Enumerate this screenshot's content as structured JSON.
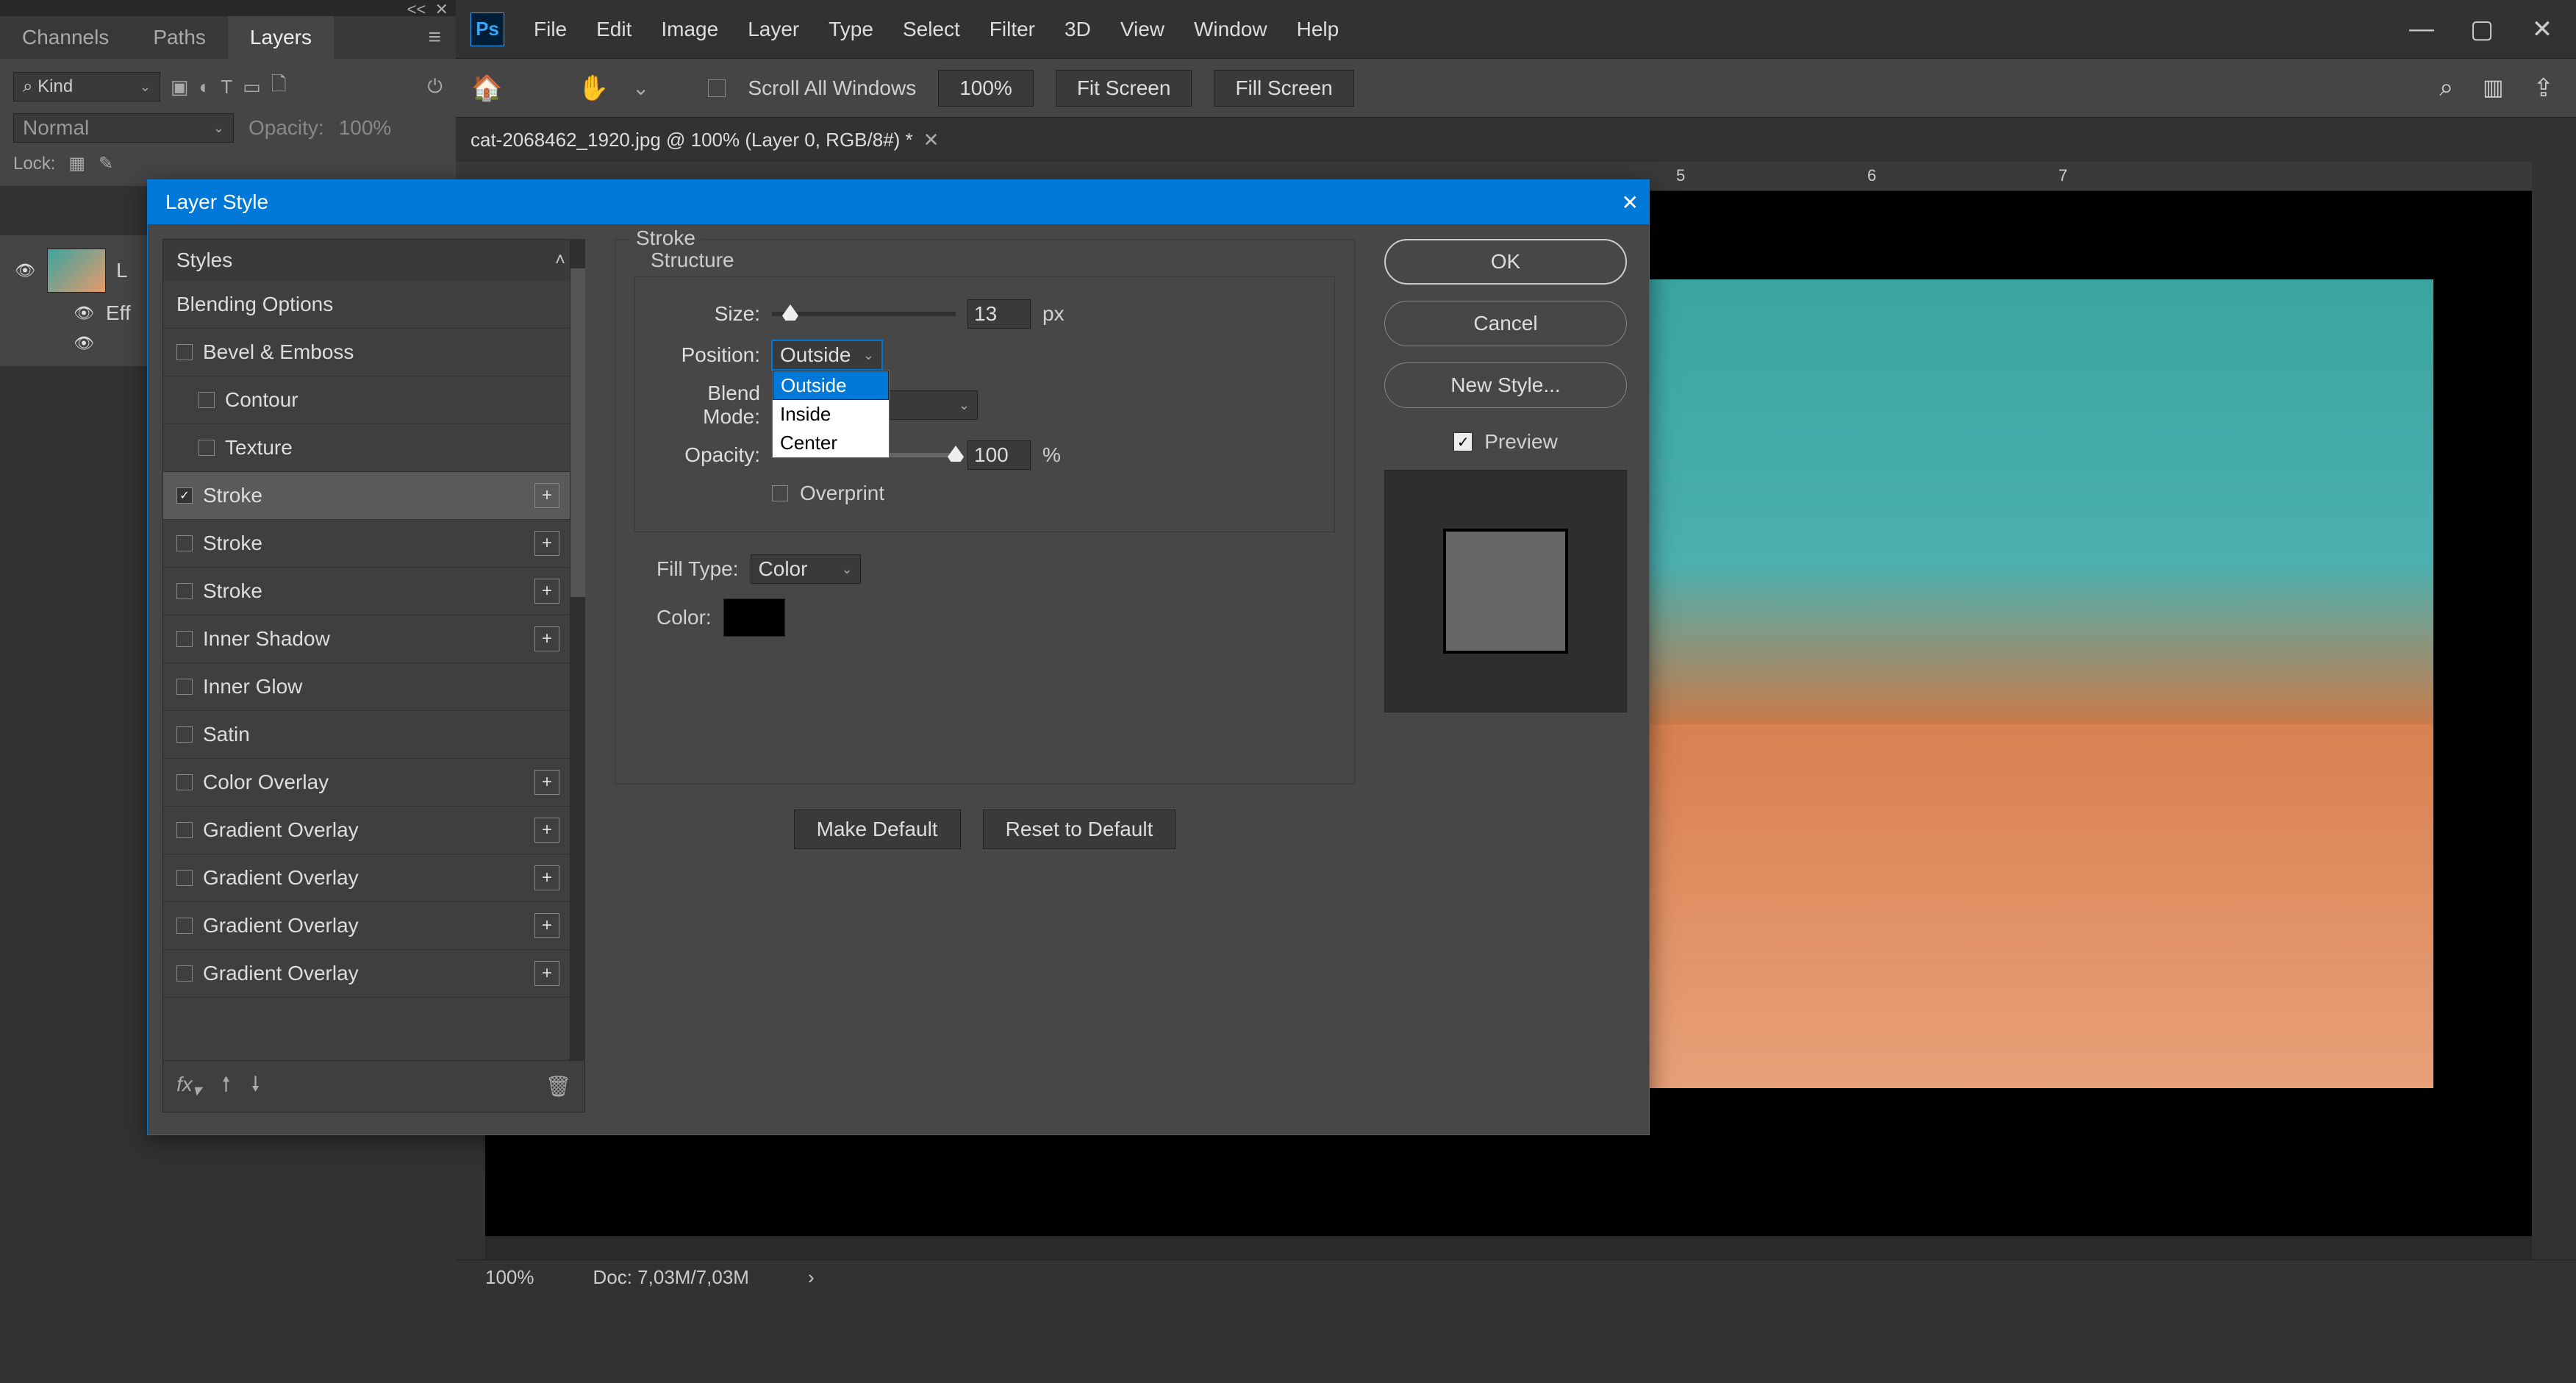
{
  "menu": {
    "items": [
      "File",
      "Edit",
      "Image",
      "Layer",
      "Type",
      "Select",
      "Filter",
      "3D",
      "View",
      "Window",
      "Help"
    ],
    "logo": "Ps"
  },
  "options": {
    "scroll_all": "Scroll All Windows",
    "zoom": "100%",
    "fit": "Fit Screen",
    "fill": "Fill Screen"
  },
  "doc_tab": "cat-2068462_1920.jpg @ 100% (Layer 0, RGB/8#) *",
  "ruler_marks": [
    "5",
    "6",
    "7"
  ],
  "status": {
    "zoom": "100%",
    "doc": "Doc: 7,03M/7,03M"
  },
  "panel": {
    "collapse": "<<",
    "tabs": [
      "Channels",
      "Paths",
      "Layers"
    ],
    "active_tab": 2,
    "kind_label": "Kind",
    "kind_search_icon": "search-icon",
    "blend_mode": "Normal",
    "opacity_label": "Opacity:",
    "opacity_value": "100%",
    "lock_label": "Lock:",
    "layer_name": "L",
    "effects_label": "Eff",
    "search_prefix": "⌕"
  },
  "dialog": {
    "title": "Layer Style",
    "styles_header": "Styles",
    "blending_options": "Blending Options",
    "style_items": [
      {
        "label": "Bevel & Emboss",
        "checked": false,
        "indent": false,
        "add": false
      },
      {
        "label": "Contour",
        "checked": false,
        "indent": true,
        "add": false
      },
      {
        "label": "Texture",
        "checked": false,
        "indent": true,
        "add": false
      },
      {
        "label": "Stroke",
        "checked": true,
        "indent": false,
        "add": true,
        "selected": true
      },
      {
        "label": "Stroke",
        "checked": false,
        "indent": false,
        "add": true
      },
      {
        "label": "Stroke",
        "checked": false,
        "indent": false,
        "add": true
      },
      {
        "label": "Inner Shadow",
        "checked": false,
        "indent": false,
        "add": true
      },
      {
        "label": "Inner Glow",
        "checked": false,
        "indent": false,
        "add": false
      },
      {
        "label": "Satin",
        "checked": false,
        "indent": false,
        "add": false
      },
      {
        "label": "Color Overlay",
        "checked": false,
        "indent": false,
        "add": true
      },
      {
        "label": "Gradient Overlay",
        "checked": false,
        "indent": false,
        "add": true
      },
      {
        "label": "Gradient Overlay",
        "checked": false,
        "indent": false,
        "add": true
      },
      {
        "label": "Gradient Overlay",
        "checked": false,
        "indent": false,
        "add": true
      },
      {
        "label": "Gradient Overlay",
        "checked": false,
        "indent": false,
        "add": true
      }
    ],
    "fx_label": "fx",
    "stroke": {
      "group": "Stroke",
      "structure": "Structure",
      "size_label": "Size:",
      "size_value": "13",
      "size_unit": "px",
      "position_label": "Position:",
      "position_value": "Outside",
      "position_options": [
        "Outside",
        "Inside",
        "Center"
      ],
      "blend_label": "Blend Mode:",
      "opacity_label": "Opacity:",
      "opacity_value": "100",
      "opacity_unit": "%",
      "overprint": "Overprint",
      "filltype_label": "Fill Type:",
      "filltype_value": "Color",
      "color_label": "Color:",
      "make_default": "Make Default",
      "reset_default": "Reset to Default"
    },
    "buttons": {
      "ok": "OK",
      "cancel": "Cancel",
      "new_style": "New Style..."
    },
    "preview_label": "Preview"
  }
}
